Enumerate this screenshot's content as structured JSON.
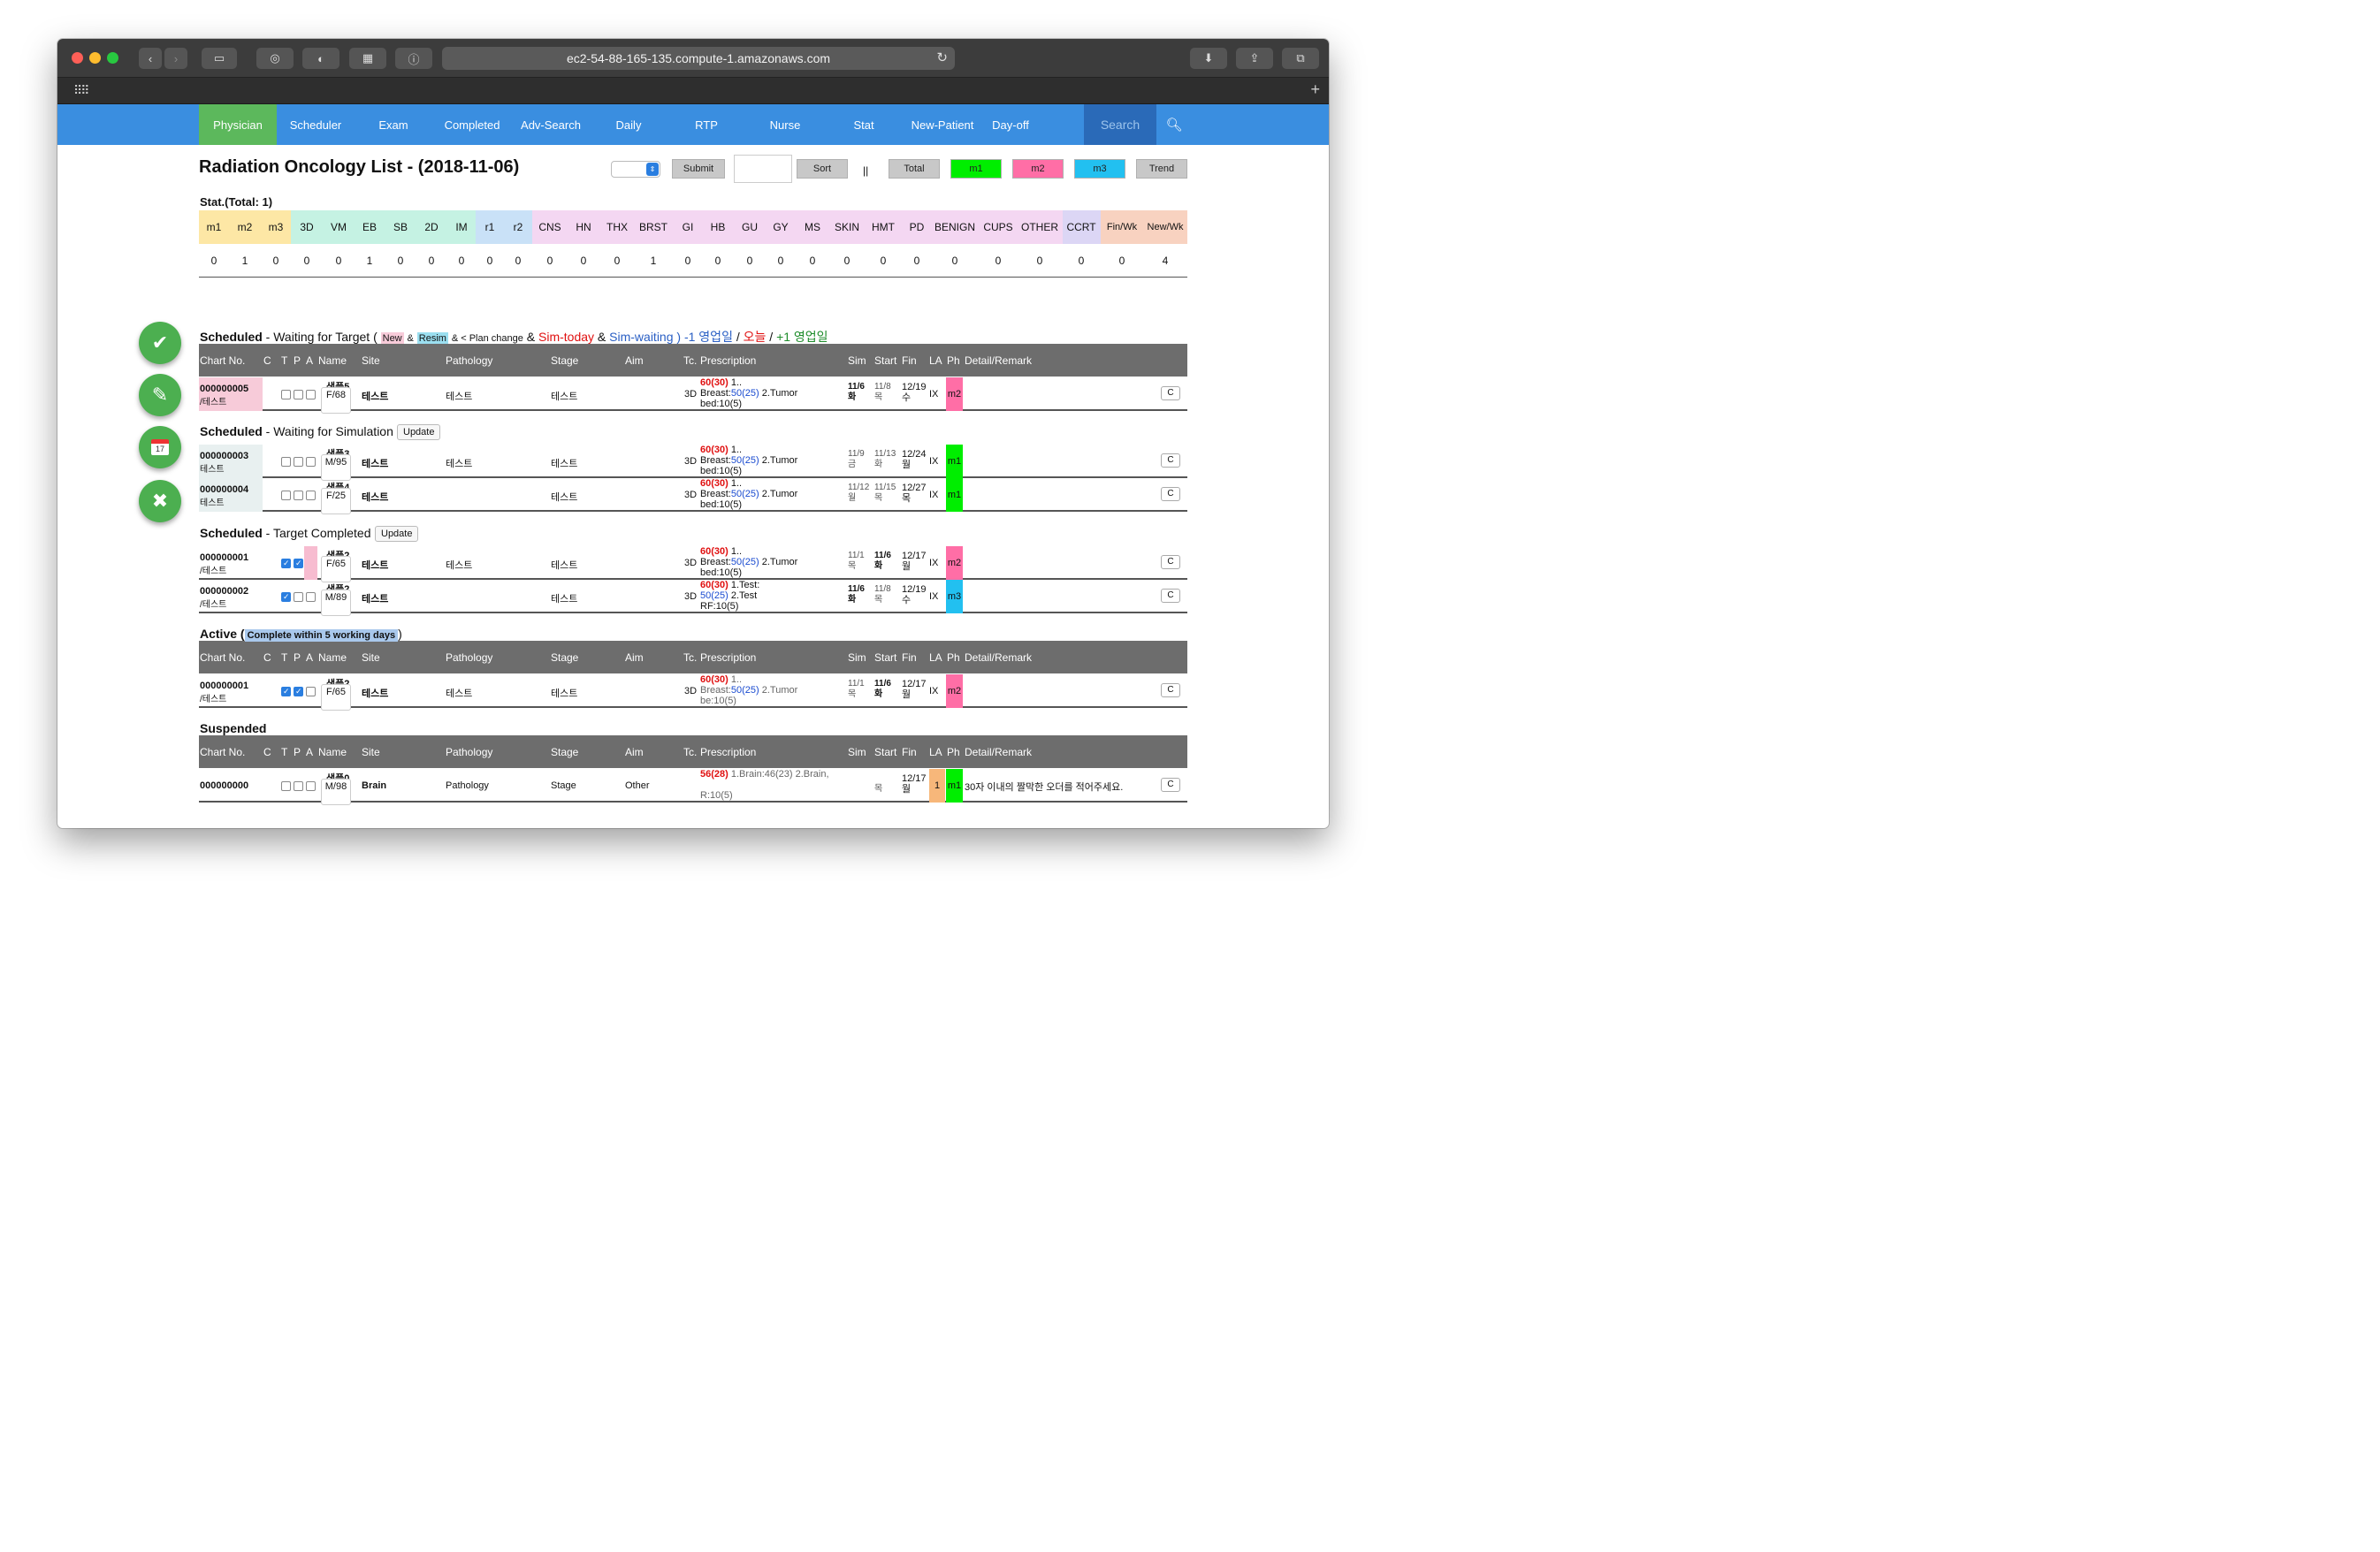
{
  "browser": {
    "url": "ec2-54-88-165-135.compute-1.amazonaws.com"
  },
  "nav": {
    "items": [
      "Physician",
      "Scheduler",
      "Exam",
      "Completed",
      "Adv-Search",
      "Daily",
      "RTP",
      "Nurse",
      "Stat",
      "New-Patient",
      "Day-off"
    ],
    "active": "Physician",
    "search": "Search"
  },
  "page": {
    "title": "Radiation Oncology List - (2018-11-06)"
  },
  "toolbar": {
    "submit": "Submit",
    "sort": "Sort",
    "sep": "||",
    "total": "Total",
    "m1": "m1",
    "m2": "m2",
    "m3": "m3",
    "trend": "Trend"
  },
  "stat": {
    "title": "Stat.(Total: 1)",
    "headers": [
      "m1",
      "m2",
      "m3",
      "3D",
      "VM",
      "EB",
      "SB",
      "2D",
      "IM",
      "r1",
      "r2",
      "CNS",
      "HN",
      "THX",
      "BRST",
      "GI",
      "HB",
      "GU",
      "GY",
      "MS",
      "SKIN",
      "HMT",
      "PD",
      "BENIGN",
      "CUPS",
      "OTHER",
      "CCRT",
      "Fin/Wk",
      "New/Wk"
    ],
    "values": [
      "0",
      "1",
      "0",
      "0",
      "0",
      "1",
      "0",
      "0",
      "0",
      "0",
      "0",
      "0",
      "0",
      "0",
      "1",
      "0",
      "0",
      "0",
      "0",
      "0",
      "0",
      "0",
      "0",
      "0",
      "0",
      "0",
      "0",
      "0",
      "4"
    ]
  },
  "columns": {
    "chart": "Chart No.",
    "c": "C",
    "t": "T",
    "p": "P",
    "a": "A",
    "name": "Name",
    "site": "Site",
    "path": "Pathology",
    "stage": "Stage",
    "aim": "Aim",
    "tc": "Tc.",
    "presc": "Prescription",
    "sim": "Sim",
    "start": "Start",
    "fin": "Fin",
    "la": "LA",
    "ph": "Ph",
    "detail": "Detail/Remark"
  },
  "legend": {
    "bold": "Scheduled",
    "dash": " - Waiting for Target (",
    "new": "New",
    "amp1": "&",
    "resim": "Resim",
    "plan": "& < Plan change",
    "amp2": "&",
    "simtoday": "Sim-today",
    "amp3": "&",
    "simwaiting": "Sim-waiting",
    "close": ")",
    "minus1": "-1 영업일",
    "slash1": "/",
    "today": "오늘",
    "slash2": "/",
    "plus1": "+1 영업일"
  },
  "sections": {
    "sim": {
      "bold": "Scheduled",
      "rest": " - Waiting for Simulation",
      "update": "Update"
    },
    "tc": {
      "bold": "Scheduled",
      "rest": " - Target Completed",
      "update": "Update"
    },
    "active": {
      "bold": "Active",
      "paren_open": "(",
      "note": "Complete within 5 working days",
      "paren_close": ")"
    },
    "suspended": {
      "bold": "Suspended"
    }
  },
  "fabs": [
    "check-icon",
    "pencil-icon",
    "calendar-icon",
    "close-icon"
  ],
  "calendar_day": "17",
  "rows": {
    "r5": {
      "chart": "000000005",
      "sub": "/테스트",
      "name": "샘플5",
      "age": "F/68",
      "site": "테스트",
      "path": "테스트",
      "stage": "테스트",
      "aim": "",
      "tc": "3D",
      "dose": "60(30)",
      "p1": "1..",
      "p2a": "Breast:",
      "p2b": "50(25)",
      "p2c": " 2.Tumor",
      "p3": "bed:10(5)",
      "sim": "11/6",
      "simd": "화",
      "start": "11/8",
      "startd": "목",
      "fin": "12/19",
      "find": "수",
      "la": "IX",
      "ph": "m2",
      "btn": "C"
    },
    "r3": {
      "chart": "000000003",
      "sub": "테스트",
      "name": "샘플3",
      "age": "M/95",
      "site": "테스트",
      "path": "테스트",
      "stage": "테스트",
      "aim": "",
      "tc": "3D",
      "dose": "60(30)",
      "p1": "1..",
      "p2a": "Breast:",
      "p2b": "50(25)",
      "p2c": " 2.Tumor",
      "p3": "bed:10(5)",
      "sim": "11/9",
      "simd": "금",
      "start": "11/13",
      "startd": "화",
      "fin": "12/24",
      "find": "월",
      "la": "IX",
      "ph": "m1",
      "btn": "C"
    },
    "r4": {
      "chart": "000000004",
      "sub": "테스트",
      "name": "샘플4",
      "age": "F/25",
      "site": "테스트",
      "path": "",
      "stage": "테스트",
      "aim": "",
      "tc": "3D",
      "dose": "60(30)",
      "p1": "1..",
      "p2a": "Breast:",
      "p2b": "50(25)",
      "p2c": " 2.Tumor",
      "p3": "bed:10(5)",
      "sim": "11/12",
      "simd": "월",
      "start": "11/15",
      "startd": "목",
      "fin": "12/27",
      "find": "목",
      "la": "IX",
      "ph": "m1",
      "btn": "C"
    },
    "r1": {
      "chart": "000000001",
      "sub": "/테스트",
      "name": "샘플2",
      "age": "F/65",
      "site": "테스트",
      "path": "테스트",
      "stage": "테스트",
      "aim": "",
      "tc": "3D",
      "dose": "60(30)",
      "p1": "1..",
      "p2a": "Breast:",
      "p2b": "50(25)",
      "p2c": " 2.Tumor",
      "p3": "bed:10(5)",
      "sim": "11/1",
      "simd": "목",
      "start": "11/6",
      "startd": "화",
      "fin": "12/17",
      "find": "월",
      "la": "IX",
      "ph": "m2",
      "btn": "C"
    },
    "r2": {
      "chart": "000000002",
      "sub": "/테스트",
      "name": "샘플2",
      "age": "M/89",
      "site": "테스트",
      "path": "",
      "stage": "테스트",
      "aim": "",
      "tc": "3D",
      "dose": "60(30)",
      "p1": "1.Test:",
      "p2a": "",
      "p2b": "50(25)",
      "p2c": " 2.Test",
      "p3": "RF:10(5)",
      "sim": "11/6",
      "simd": "화",
      "start": "11/8",
      "startd": "목",
      "fin": "12/19",
      "find": "수",
      "la": "IX",
      "ph": "m3",
      "btn": "C"
    },
    "ra": {
      "chart": "000000001",
      "sub": "/테스트",
      "name": "샘플2",
      "age": "F/65",
      "site": "테스트",
      "path": "테스트",
      "stage": "테스트",
      "aim": "",
      "tc": "3D",
      "dose": "60(30)",
      "p1": "1..",
      "p2a": "Breast:",
      "p2b": "50(25)",
      "p2c": " 2.Tumor",
      "p3": "be:10(5)",
      "sim": "11/1",
      "simd": "목",
      "start": "11/6",
      "startd": "화",
      "fin": "12/17",
      "find": "월",
      "la": "IX",
      "ph": "m2",
      "btn": "C"
    },
    "r0": {
      "chart": "000000000",
      "sub": "",
      "name": "샘플0",
      "age": "M/98",
      "site": "Brain",
      "path": "Pathology",
      "stage": "Stage",
      "aim": "Other",
      "tc": "",
      "dose": "56(28)",
      "p1": "1.Brain:46(23) 2.Brain,",
      "p2a": "",
      "p2b": "",
      "p2c": "",
      "p3": "R:10(5)",
      "sim": "",
      "simd": "",
      "start": "",
      "startd": "목",
      "fin": "12/17",
      "find": "월",
      "la": "1",
      "ph": "m1",
      "remark": "30자 이내의 짤막한 오더를 적어주세요.",
      "btn": "C"
    }
  },
  "colors": {
    "nav_bg": "#3a8ee0",
    "nav_active": "#5cb85c",
    "search_bg": "#2a6ab8",
    "m1": "#00ee00",
    "m2": "#ff6ea6",
    "m3": "#22c0f0",
    "header_gray": "#6d6d6d",
    "fab_green": "#4caf50"
  }
}
